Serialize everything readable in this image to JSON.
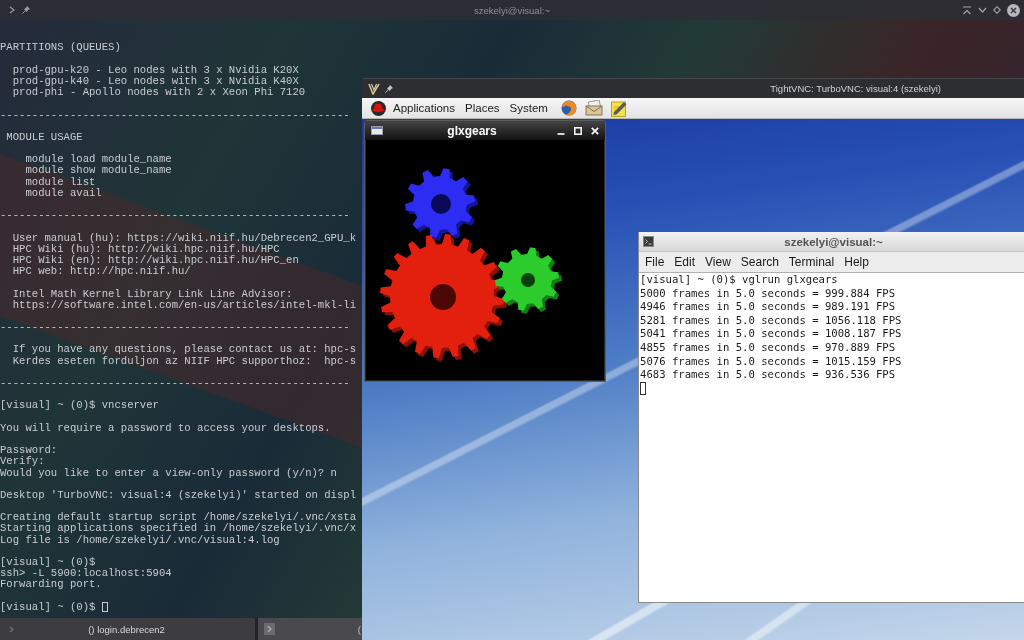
{
  "window": {
    "title": "szekelyi@visual:~"
  },
  "terminal": {
    "blocks": [
      [
        "PARTITIONS (QUEUES)"
      ],
      [
        "  prod-gpu-k20 - Leo nodes with 3 x Nvidia K20X",
        "  prod-gpu-k40 - Leo nodes with 3 x Nvidia K40X",
        "  prod-phi - Apollo nodes with 2 x Xeon Phi 7120"
      ],
      [
        "-------------------------------------------------------"
      ],
      [
        " MODULE USAGE"
      ],
      [
        "    module load module_name",
        "    module show module_name",
        "    module list",
        "    module avail"
      ],
      [
        "-------------------------------------------------------"
      ],
      [
        "  User manual (hu): https://wiki.niif.hu/Debrecen2_GPU_k",
        "  HPC Wiki (hu): http://wiki.hpc.niif.hu/HPC",
        "  HPC Wiki (en): http://wiki.hpc.niif.hu/HPC_en",
        "  HPC web: http://hpc.niif.hu/"
      ],
      [
        "  Intel Math Kernel Library Link Line Advisor:",
        "  https://software.intel.com/en-us/articles/intel-mkl-li"
      ],
      [
        "-------------------------------------------------------"
      ],
      [
        "  If you have any questions, please contact us at: hpc-s",
        "  Kerdes eseten forduljon az NIIF HPC supporthoz:  hpc-s"
      ],
      [
        "-------------------------------------------------------"
      ],
      [
        "[visual] ~ (0)$ vncserver"
      ],
      [
        "You will require a password to access your desktops."
      ],
      [
        "Password:",
        "Verify:",
        "Would you like to enter a view-only password (y/n)? n"
      ],
      [
        "Desktop 'TurboVNC: visual:4 (szekelyi)' started on displ"
      ],
      [
        "Creating default startup script /home/szekelyi/.vnc/xsta",
        "Starting applications specified in /home/szekelyi/.vnc/x",
        "Log file is /home/szekelyi/.vnc/visual:4.log"
      ],
      [
        "[visual] ~ (0)$",
        "ssh> -L 5900:localhost:5904",
        "Forwarding port."
      ],
      [
        "[visual] ~ (0)$"
      ]
    ]
  },
  "vnc_window": {
    "title": "TightVNC: TurboVNC: visual:4 (szekelyi)",
    "panel_menus": [
      "Applications",
      "Places",
      "System"
    ],
    "glxgears_window": {
      "title": "glxgears"
    },
    "terminal_window": {
      "title": "szekelyi@visual:~",
      "menus": [
        "File",
        "Edit",
        "View",
        "Search",
        "Terminal",
        "Help"
      ],
      "lines": [
        "[visual] ~ (0)$ vglrun glxgears",
        "5000 frames in 5.0 seconds = 999.884 FPS",
        "4946 frames in 5.0 seconds = 989.191 FPS",
        "5281 frames in 5.0 seconds = 1056.118 FPS",
        "5041 frames in 5.0 seconds = 1008.187 FPS",
        "4855 frames in 5.0 seconds = 970.889 FPS",
        "5076 frames in 5.0 seconds = 1015.159 FPS",
        "4683 frames in 5.0 seconds = 936.536 FPS"
      ]
    }
  },
  "tabs": [
    {
      "label": "() login.debrecen2",
      "selected": true
    },
    {
      "label": "(",
      "selected": false
    }
  ]
}
